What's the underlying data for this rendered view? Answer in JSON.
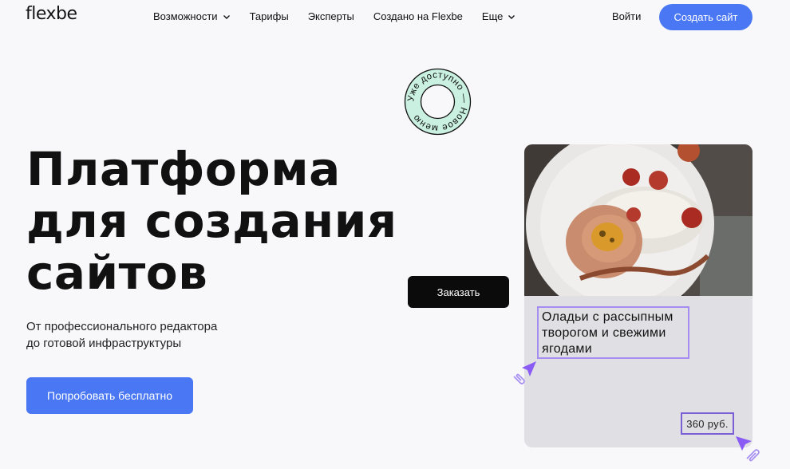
{
  "header": {
    "logo": "flexbe",
    "nav": [
      {
        "label": "Возможности",
        "has_dropdown": true
      },
      {
        "label": "Тарифы",
        "has_dropdown": false
      },
      {
        "label": "Эксперты",
        "has_dropdown": false
      },
      {
        "label": "Создано на Flexbe",
        "has_dropdown": false
      },
      {
        "label": "Еще",
        "has_dropdown": true
      }
    ],
    "login_label": "Войти",
    "create_button_label": "Создать сайт"
  },
  "badge": {
    "text": "Уже доступно — Новое меню"
  },
  "hero": {
    "title_lines": [
      "Платформа",
      "для создания",
      "сайтов"
    ],
    "subtitle_lines": [
      "От профессионального редактора",
      "до готовой инфраструктуры"
    ],
    "cta_label": "Попробовать бесплатно"
  },
  "demo_card": {
    "dish_name_lines": [
      "Оладьи с рассыпным",
      "творогом и свежими",
      "ягодами"
    ],
    "price": "360 руб.",
    "order_button_label": "Заказать"
  },
  "colors": {
    "accent": "#4a78f5",
    "badge_mint": "#c9f0e1",
    "selection_purple": "#a48cf0",
    "cursor_purple": "#8a5cf5"
  },
  "icons": [
    "chevron-down-icon",
    "cursor-arrow-icon",
    "paperclip-icon"
  ]
}
